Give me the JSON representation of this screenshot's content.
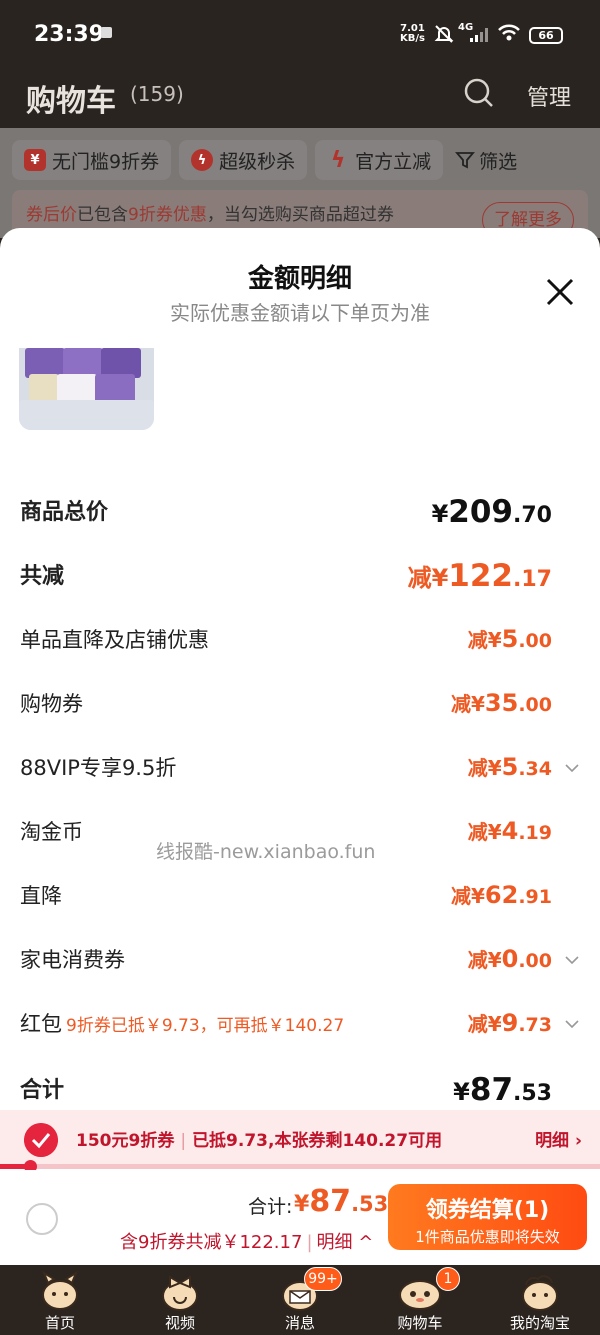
{
  "status_bar": {
    "time": "23:39",
    "net_speed_value": "7.01",
    "net_speed_unit": "KB/s",
    "network": "4G",
    "battery": "66"
  },
  "header": {
    "title": "购物车",
    "count": "(159)",
    "manage": "管理",
    "search_icon": "search-icon"
  },
  "filters": [
    {
      "label": "无门槛9折券",
      "icon": "coupon-icon",
      "color": "#c62828"
    },
    {
      "label": "超级秒杀",
      "icon": "lightning-icon",
      "color": "#c62828"
    },
    {
      "label": "官方立减",
      "icon": "bolt-icon",
      "color": "#c62828"
    },
    {
      "label": "筛选",
      "icon": "filter-icon"
    }
  ],
  "promo_banner": {
    "part1": "券后价",
    "part2": "已包含",
    "part3": "9折券优惠",
    "part4": "，当勾选购买商品超过券",
    "learn_more": "了解更多"
  },
  "sheet": {
    "title": "金额明细",
    "subtitle": "实际优惠金额请以下单页为准",
    "product_image": "tissue-pack"
  },
  "details": {
    "total_price": {
      "label": "商品总价",
      "symbol": "¥",
      "main": "209",
      "decimal": ".70"
    },
    "total_discount": {
      "label": "共减",
      "prefix": "减¥",
      "main": "122",
      "decimal": ".17"
    },
    "items": [
      {
        "label": "单品直降及店铺优惠",
        "note": "",
        "prefix": "减¥",
        "main": "5",
        "decimal": ".00",
        "expandable": false
      },
      {
        "label": "购物券",
        "note": "",
        "prefix": "减¥",
        "main": "35",
        "decimal": ".00",
        "expandable": false
      },
      {
        "label": "88VIP专享9.5折",
        "note": "",
        "prefix": "减¥",
        "main": "5",
        "decimal": ".34",
        "expandable": true
      },
      {
        "label": "淘金币",
        "note": "",
        "prefix": "减¥",
        "main": "4",
        "decimal": ".19",
        "expandable": false
      },
      {
        "label": "直降",
        "note": "",
        "prefix": "减¥",
        "main": "62",
        "decimal": ".91",
        "expandable": false
      },
      {
        "label": "家电消费券",
        "note": "",
        "prefix": "减¥",
        "main": "0",
        "decimal": ".00",
        "expandable": true
      },
      {
        "label": "红包",
        "note": "9折券已抵￥9.73，可再抵￥140.27",
        "prefix": "减¥",
        "main": "9",
        "decimal": ".73",
        "expandable": true
      }
    ],
    "subtotal": {
      "label": "合计",
      "symbol": "¥",
      "main": "87",
      "decimal": ".53"
    }
  },
  "watermark": "线报酷-new.xianbao.fun",
  "coupon_bar": {
    "coupon": "150元9折券",
    "status": "已抵9.73,本张券剩140.27可用",
    "detail": "明细 ›",
    "progress": 0.05
  },
  "bottom_bar": {
    "total_label": "合计:",
    "total_symbol": "¥",
    "total_main": "87",
    "total_decimal": ".53",
    "saving": "含9折券共减￥122.17",
    "saving_detail": "明细 ^",
    "checkout": "领券结算(1)",
    "checkout_sub": "1件商品优惠即将失效",
    "accent": "#ff5a14"
  },
  "tabs": [
    {
      "label": "首页",
      "icon": "home-mascot-icon"
    },
    {
      "label": "视频",
      "icon": "video-mascot-icon"
    },
    {
      "label": "消息",
      "icon": "message-mascot-icon",
      "badge": "99+"
    },
    {
      "label": "购物车",
      "icon": "cart-mascot-icon",
      "badge": "1"
    },
    {
      "label": "我的淘宝",
      "icon": "profile-mascot-icon"
    }
  ]
}
